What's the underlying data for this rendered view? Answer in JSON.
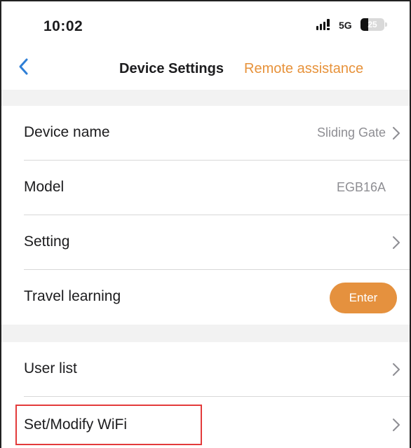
{
  "status_bar": {
    "time": "10:02",
    "network": "5G",
    "battery": "25"
  },
  "nav": {
    "title": "Device Settings",
    "action": "Remote assistance"
  },
  "rows": [
    {
      "label": "Device name",
      "value": "Sliding Gate",
      "chevron": true
    },
    {
      "label": "Model",
      "value": "EGB16A",
      "chevron": false
    },
    {
      "label": "Setting",
      "value": "",
      "chevron": true
    },
    {
      "label": "Travel learning",
      "button": "Enter"
    },
    {
      "label": "User list",
      "value": "",
      "chevron": true
    },
    {
      "label": "Set/Modify WiFi",
      "value": "",
      "chevron": true,
      "highlighted": true
    }
  ],
  "colors": {
    "accent": "#e7923a",
    "back_arrow": "#2f7fd6",
    "highlight": "#e33b3b",
    "section_gap": "#f2f2f2"
  },
  "icons": {
    "back": "chevron-left-icon",
    "row_arrow": "chevron-right-icon",
    "signal": "signal-strength-icon",
    "battery": "battery-icon"
  }
}
